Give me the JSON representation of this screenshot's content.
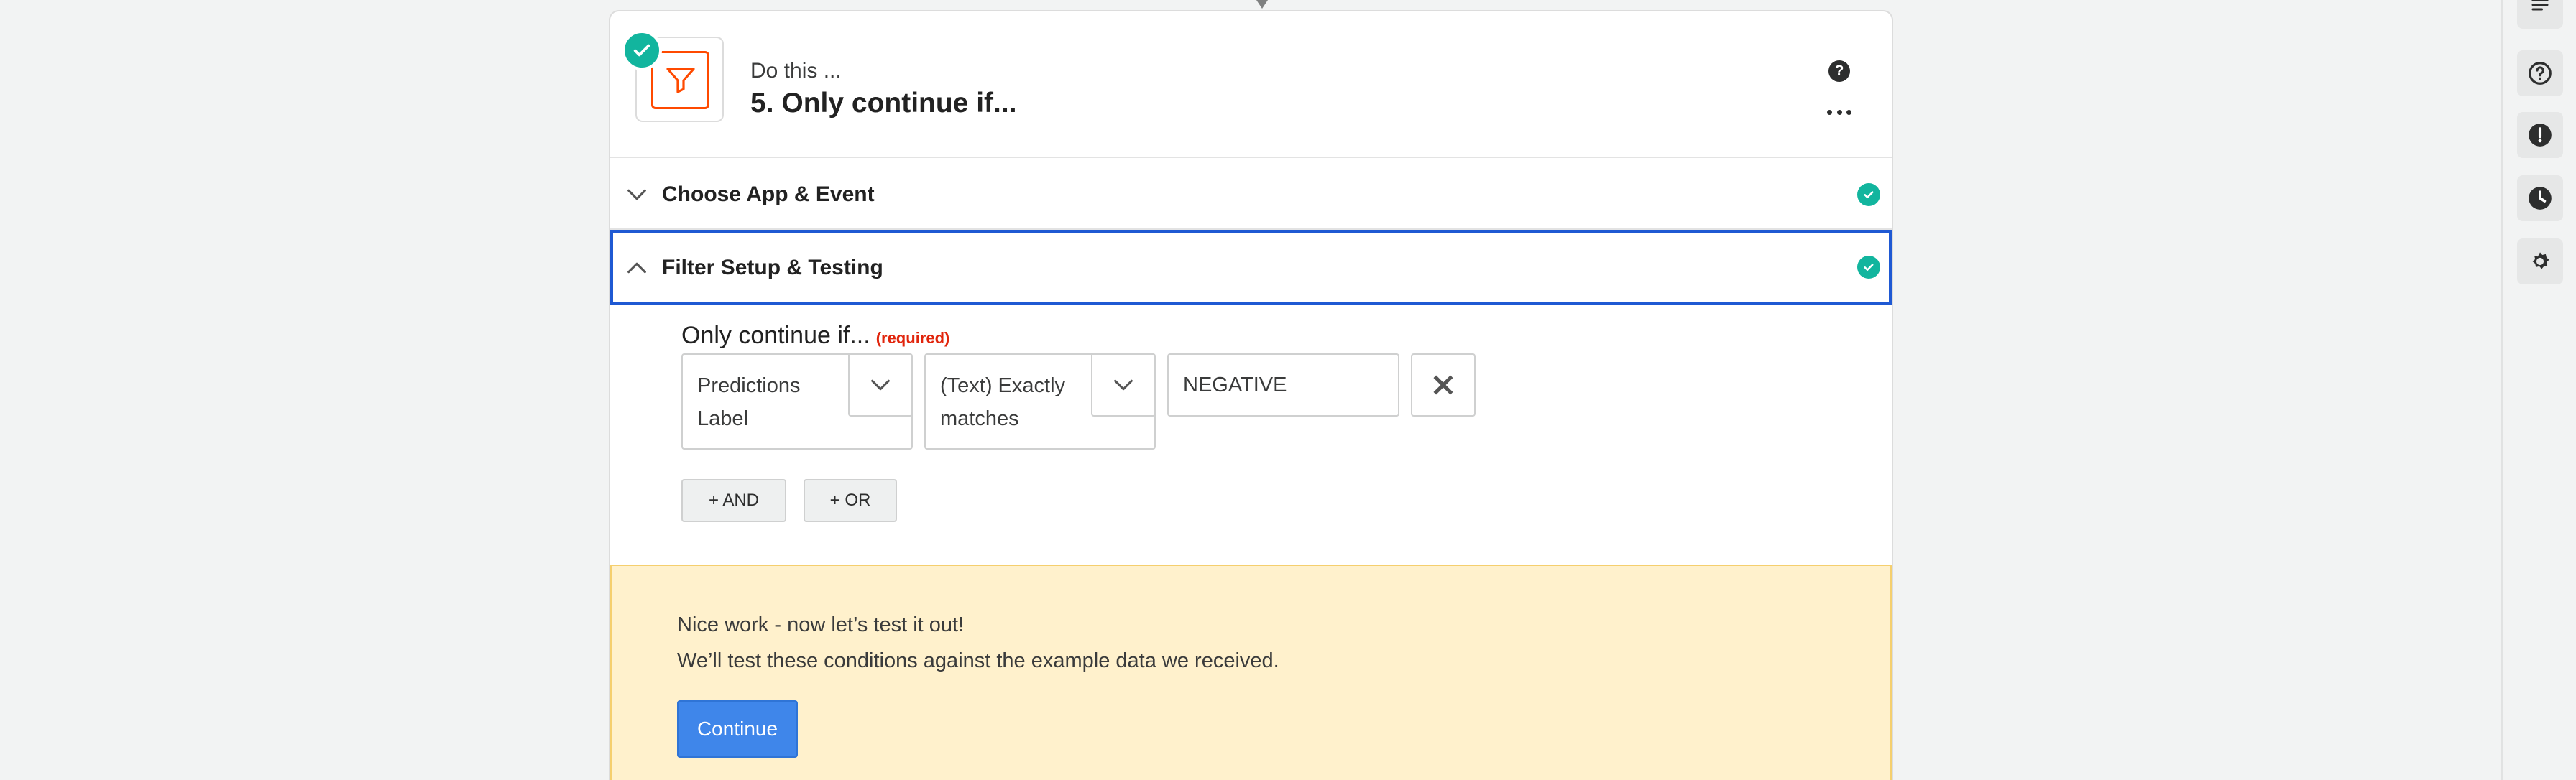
{
  "step": {
    "kicker": "Do this ...",
    "title": "5. Only continue if...",
    "help_glyph": "?",
    "icons": {
      "app": "filter-icon",
      "status": "check-circle-icon",
      "help": "question-circle-icon",
      "menu": "more-horizontal-icon"
    }
  },
  "sections": {
    "choose": {
      "title": "Choose App & Event",
      "state": "collapsed",
      "status": "complete"
    },
    "filter": {
      "title": "Filter Setup & Testing",
      "state": "expanded",
      "status": "complete"
    }
  },
  "filter": {
    "label": "Only continue if...",
    "required": "(required)",
    "condition": {
      "field": "Predictions Label",
      "operator": "(Text) Exactly matches",
      "value": "NEGATIVE"
    },
    "and_label": "+ AND",
    "or_label": "+ OR"
  },
  "notice": {
    "line1": "Nice work - now let’s test it out!",
    "line2": "We’ll test these conditions against the example data we received.",
    "button": "Continue"
  },
  "right_rail": {
    "icons": [
      "notes-icon",
      "help-circle-icon",
      "alert-icon",
      "history-clock-icon",
      "settings-gear-icon"
    ]
  },
  "colors": {
    "accent_blue": "#1f59d3",
    "success_green": "#12b59e",
    "brand_orange": "#ff4a00",
    "notice_bg": "#fff1cc",
    "button_blue": "#3f86ea",
    "required_red": "#e1250c"
  }
}
